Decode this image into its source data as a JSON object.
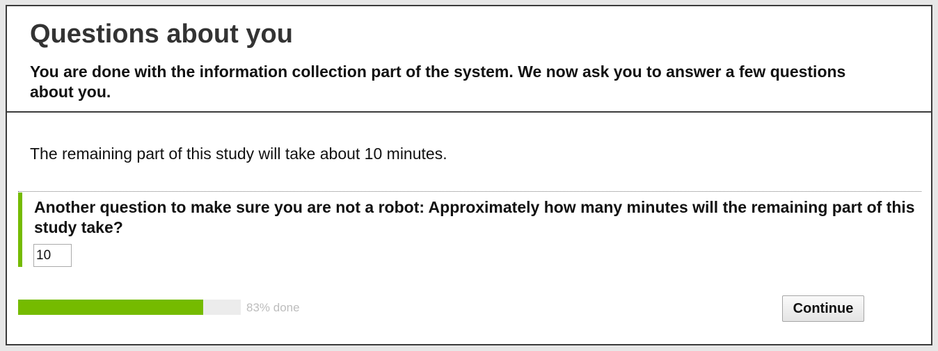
{
  "header": {
    "title": "Questions about you",
    "subtitle": "You are done with the information collection part of the system. We now ask you to answer a few questions about you."
  },
  "main": {
    "intro": "The remaining part of this study will take about 10 minutes.",
    "question": {
      "label": "Another question to make sure you are not a robot: Approximately how many minutes will the remaining part of this study take?",
      "value": "10"
    }
  },
  "footer": {
    "progress": {
      "percent": 83,
      "text": "83% done"
    },
    "continue_label": "Continue"
  },
  "colors": {
    "accent": "#75bb00",
    "border": "#3b3b3b"
  }
}
